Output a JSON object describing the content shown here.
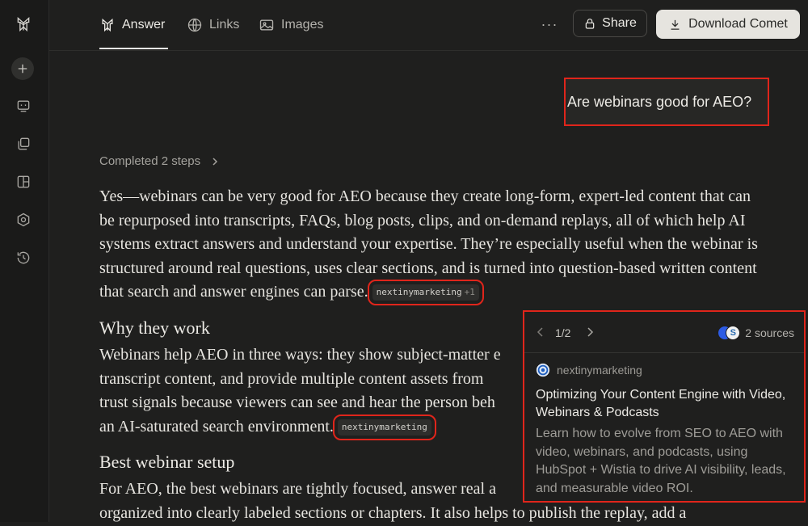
{
  "tabs": [
    {
      "label": "Answer",
      "icon": "perplexity-answer-icon",
      "active": true
    },
    {
      "label": "Links",
      "icon": "globe-icon",
      "active": false
    },
    {
      "label": "Images",
      "icon": "image-icon",
      "active": false
    }
  ],
  "toolbar": {
    "more_label": "···",
    "share_label": "Share",
    "download_label": "Download Comet"
  },
  "query": "Are webinars good for AEO?",
  "steps_label": "Completed 2 steps",
  "answer": {
    "intro": "Yes—webinars can be very good for AEO because they create long-form, expert-led content that can be repurposed into transcripts, FAQs, blog posts, clips, and on-demand replays, all of which help AI systems extract answers and understand your expertise. They’re especially useful when the webinar is structured around real questions, uses clear sections, and is turned into question-based written content that search and answer engines can parse.",
    "cite1_label": "nextinymarketing",
    "cite1_extra": "+1",
    "h_why": "Why they work",
    "why_text": "Webinars help AEO in three ways: they show subject-matter e",
    "why_text2": "transcript content, and provide multiple content assets from",
    "why_text3": "trust signals because viewers can see and hear the person beh",
    "why_text4": "an AI-saturated search environment.",
    "cite2_label": "nextinymarketing",
    "h_best": "Best webinar setup",
    "best_text": "For AEO, the best webinars are tightly focused, answer real a",
    "best_text2": "organized into clearly labeled sections or chapters. It also helps to publish the replay, add a"
  },
  "popover": {
    "count": "1/2",
    "sources_label": "2 sources",
    "site": "nextinymarketing",
    "title": "Optimizing Your Content Engine with Video, Webinars & Podcasts",
    "description": "Learn how to evolve from SEO to AEO with video, webinars, and podcasts, using HubSpot + Wistia to drive AI visibility, leads, and measurable video ROI."
  },
  "colors": {
    "background": "#1f1f1e",
    "highlight": "#e0251b",
    "accent_button": "#e6e4df"
  }
}
